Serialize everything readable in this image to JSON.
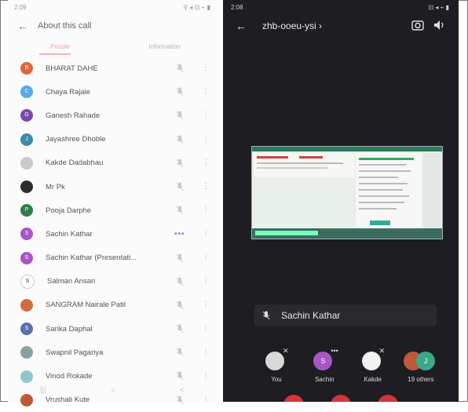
{
  "left": {
    "status": {
      "time": "2:09",
      "icons": "⚲ ◂ ⊡ ⌁ ▮"
    },
    "title": "About this call",
    "tabs": [
      {
        "label": "People",
        "active": true
      },
      {
        "label": "Information",
        "active": false
      }
    ],
    "participants": [
      {
        "name": "BHARAT DAHE",
        "avatar_color": "#e2663a",
        "initial": "B",
        "status": "muted"
      },
      {
        "name": "Chaya Rajale",
        "avatar_color": "#5aa7e6",
        "initial": "C",
        "status": "muted"
      },
      {
        "name": "Ganesh Rahade",
        "avatar_color": "#7b49a8",
        "initial": "G",
        "status": "muted"
      },
      {
        "name": "Jayashree Dhoble",
        "avatar_color": "#3a8aa8",
        "initial": "J",
        "status": "muted"
      },
      {
        "name": "Kakde Dadabhau",
        "avatar_color": "#c9c9c9",
        "initial": "",
        "status": "muted"
      },
      {
        "name": "Mr Pk",
        "avatar_color": "#2d2d2d",
        "initial": "",
        "status": "muted"
      },
      {
        "name": "Pooja Darphe",
        "avatar_color": "#2f7d4b",
        "initial": "P",
        "status": "muted"
      },
      {
        "name": "Sachin Kathar",
        "avatar_color": "#a855c7",
        "initial": "S",
        "status": "speaking"
      },
      {
        "name": "Sachin Kathar (Presentati...",
        "avatar_color": "#a855c7",
        "initial": "S",
        "status": "muted"
      },
      {
        "name": "Salman Ansari",
        "avatar_color": "#ffffff",
        "initial": "S",
        "status": "muted"
      },
      {
        "name": "SANGRAM Nairale Patil",
        "avatar_color": "#d36a3f",
        "initial": "",
        "status": "muted"
      },
      {
        "name": "Sarika Daphal",
        "avatar_color": "#5b6fa8",
        "initial": "S",
        "status": "muted"
      },
      {
        "name": "Swapnil Pagariya",
        "avatar_color": "#8aa0a0",
        "initial": "",
        "status": "muted"
      },
      {
        "name": "Vinod Rokade",
        "avatar_color": "#8fc6cf",
        "initial": "",
        "status": "muted"
      },
      {
        "name": "Vrushali Kute",
        "avatar_color": "#c0583a",
        "initial": "",
        "status": "muted"
      }
    ],
    "nav": [
      "|||",
      "○",
      "<"
    ]
  },
  "right": {
    "status": {
      "time": "2:08",
      "icons": "⊡ ◂ ⌁ ▮"
    },
    "meeting_code": "zhb-ooeu-ysi",
    "pinned_name": "Sachin Kathar",
    "tiles": [
      {
        "label": "You",
        "avatar_color": "#d9d9d9",
        "initial": ""
      },
      {
        "label": "Sachin",
        "avatar_color": "#a855c7",
        "initial": "S"
      },
      {
        "label": "Kakde",
        "avatar_color": "#f2f2f2",
        "initial": ""
      },
      {
        "label": "19 others",
        "avatar_color": "#3aa88a",
        "initial": "J"
      }
    ]
  }
}
